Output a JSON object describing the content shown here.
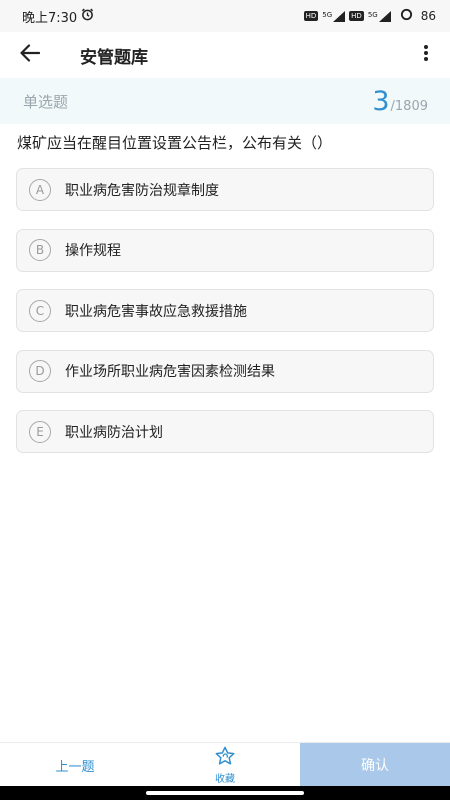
{
  "status_bar": {
    "time": "晚上7:30",
    "hd_label": "HD",
    "signal_label": "5G",
    "battery": "86"
  },
  "app_bar": {
    "title": "安管题库"
  },
  "question": {
    "type": "单选题",
    "current": "3",
    "total": "/1809",
    "text": "煤矿应当在醒目位置设置公告栏，公布有关（）",
    "options": [
      {
        "letter": "A",
        "text": "职业病危害防治规章制度"
      },
      {
        "letter": "B",
        "text": "操作规程"
      },
      {
        "letter": "C",
        "text": "职业病危害事故应急救援措施"
      },
      {
        "letter": "D",
        "text": "作业场所职业病危害因素检测结果"
      },
      {
        "letter": "E",
        "text": "职业病防治计划"
      }
    ]
  },
  "bottom_bar": {
    "prev_label": "上一题",
    "favorite_label": "收藏",
    "confirm_label": "确认"
  },
  "colors": {
    "accent": "#2f8fd1",
    "type_bar_bg": "#f1f9fa",
    "confirm_bg": "#a9c8ea",
    "option_bg": "#f7f7f7"
  }
}
